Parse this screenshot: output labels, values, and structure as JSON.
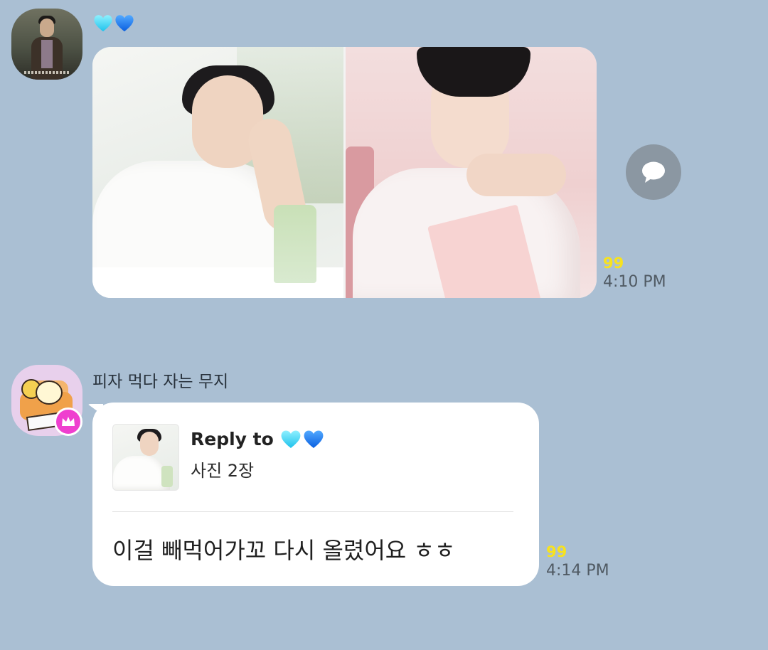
{
  "colors": {
    "background": "#aabfd3",
    "bubble": "#ffffff",
    "read_count": "#f7e21f",
    "reply_icon_bg": "#8b97a2",
    "crown_badge": "#ef3fcf"
  },
  "messages": [
    {
      "sender_display": "heart-emojis",
      "sender_icons": [
        "light-blue-heart-icon",
        "blue-heart-icon"
      ],
      "type": "photo-album",
      "photos": [
        {
          "description_icon": "photo-thumbnail"
        },
        {
          "description_icon": "photo-thumbnail"
        }
      ],
      "unread_count": "99",
      "time": "4:10 PM"
    },
    {
      "sender_name": "피자 먹다 자는 무지",
      "type": "reply",
      "reply": {
        "label": "Reply to",
        "target_icons": [
          "light-blue-heart-icon",
          "blue-heart-icon"
        ],
        "summary": "사진 2장"
      },
      "text": "이걸 빼먹어가꼬 다시 올렸어요 ㅎㅎ",
      "unread_count": "99",
      "time": "4:14 PM"
    }
  ]
}
